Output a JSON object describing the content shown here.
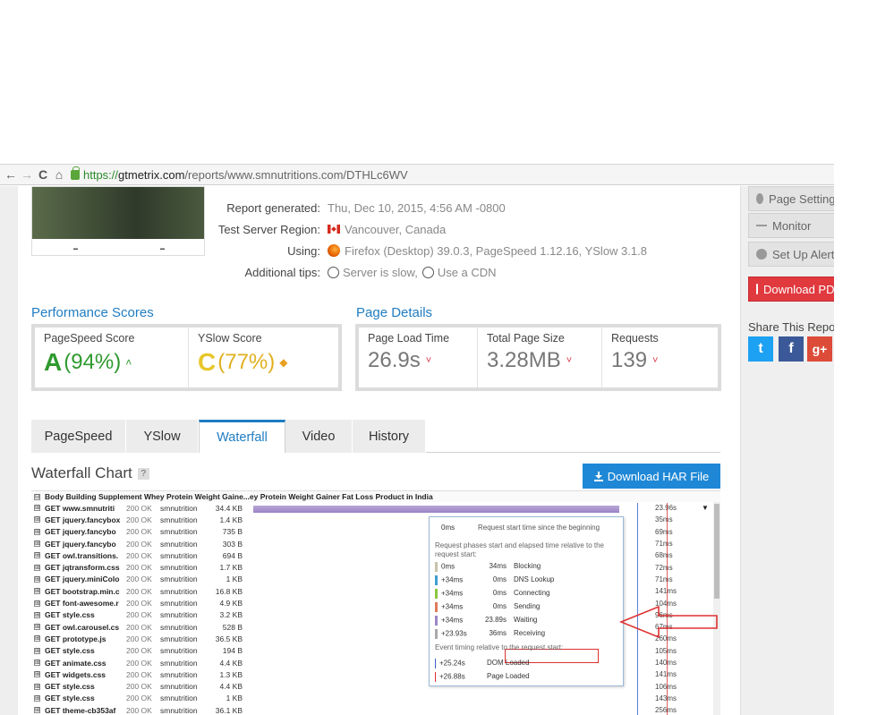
{
  "browser": {
    "back_icon": "←",
    "forward_icon": "→",
    "reload_icon": "C",
    "home_icon": "⌂",
    "url_https": "https://",
    "url_host": "gtmetrix.com",
    "url_path": "/reports/www.smnutritions.com/DTHLc6WV"
  },
  "report": {
    "rows": [
      {
        "label": "Report generated:",
        "value": "Thu, Dec 10, 2015, 4:56 AM -0800"
      },
      {
        "label": "Test Server Region:",
        "value": "Vancouver, Canada"
      },
      {
        "label": "Using:",
        "value": "Firefox (Desktop) 39.0.3, PageSpeed 1.12.16, YSlow 3.1.8"
      },
      {
        "label": "Additional tips:",
        "value": "Server is slow,",
        "value2": "Use a CDN"
      }
    ]
  },
  "performance": {
    "title": "Performance Scores",
    "pagespeed": {
      "label": "PageSpeed Score",
      "grade": "A",
      "pct": "(94%)",
      "trend": "˄"
    },
    "yslow": {
      "label": "YSlow Score",
      "grade": "C",
      "pct": "(77%)",
      "trend": "◆"
    }
  },
  "details": {
    "title": "Page Details",
    "items": [
      {
        "label": "Page Load Time",
        "value": "26.9s"
      },
      {
        "label": "Total Page Size",
        "value": "3.28MB"
      },
      {
        "label": "Requests",
        "value": "139"
      }
    ],
    "down": "˅"
  },
  "tabs": [
    "PageSpeed",
    "YSlow",
    "Waterfall",
    "Video",
    "History"
  ],
  "waterfall": {
    "title": "Waterfall Chart",
    "help": "?",
    "download_label": "Download HAR File",
    "page_title": "Body Building Supplement Whey Protein Weight Gaine...ey Protein Weight Gainer Fat Loss Product in India",
    "plus": "⊞",
    "minus": "⊟",
    "first_time": "23.96s",
    "rows": [
      {
        "name": "GET www.smnutriti",
        "status": "200 OK",
        "domain": "smnutrition",
        "size": "34.4 KB",
        "time": "23.96s"
      },
      {
        "name": "GET jquery.fancybox",
        "status": "200 OK",
        "domain": "smnutrition",
        "size": "1.4 KB",
        "time": "35ms"
      },
      {
        "name": "GET jquery.fancybo",
        "status": "200 OK",
        "domain": "smnutrition",
        "size": "735 B",
        "time": "69ms"
      },
      {
        "name": "GET jquery.fancybo",
        "status": "200 OK",
        "domain": "smnutrition",
        "size": "303 B",
        "time": "71ms"
      },
      {
        "name": "GET owl.transitions.",
        "status": "200 OK",
        "domain": "smnutrition",
        "size": "694 B",
        "time": "68ms"
      },
      {
        "name": "GET jqtransform.css",
        "status": "200 OK",
        "domain": "smnutrition",
        "size": "1.7 KB",
        "time": "72ms"
      },
      {
        "name": "GET jquery.miniColo",
        "status": "200 OK",
        "domain": "smnutrition",
        "size": "1 KB",
        "time": "71ms"
      },
      {
        "name": "GET bootstrap.min.c",
        "status": "200 OK",
        "domain": "smnutrition",
        "size": "16.8 KB",
        "time": "141ms"
      },
      {
        "name": "GET font-awesome.r",
        "status": "200 OK",
        "domain": "smnutrition",
        "size": "4.9 KB",
        "time": "104ms"
      },
      {
        "name": "GET style.css",
        "status": "200 OK",
        "domain": "smnutrition",
        "size": "3.2 KB",
        "time": "96ms"
      },
      {
        "name": "GET owl.carousel.cs",
        "status": "200 OK",
        "domain": "smnutrition",
        "size": "528 B",
        "time": "67ms"
      },
      {
        "name": "GET prototype.js",
        "status": "200 OK",
        "domain": "smnutrition",
        "size": "36.5 KB",
        "time": "260ms"
      },
      {
        "name": "GET style.css",
        "status": "200 OK",
        "domain": "smnutrition",
        "size": "194 B",
        "time": "105ms"
      },
      {
        "name": "GET animate.css",
        "status": "200 OK",
        "domain": "smnutrition",
        "size": "4.4 KB",
        "time": "140ms"
      },
      {
        "name": "GET widgets.css",
        "status": "200 OK",
        "domain": "smnutrition",
        "size": "1.3 KB",
        "time": "141ms"
      },
      {
        "name": "GET style.css",
        "status": "200 OK",
        "domain": "smnutrition",
        "size": "4.4 KB",
        "time": "106ms"
      },
      {
        "name": "GET style.css",
        "status": "200 OK",
        "domain": "smnutrition",
        "size": "1 KB",
        "time": "143ms"
      },
      {
        "name": "GET theme-cb353af",
        "status": "200 OK",
        "domain": "smnutrition",
        "size": "36.1 KB",
        "time": "256ms"
      }
    ]
  },
  "tooltip": {
    "start_time": "0ms",
    "start_text": "Request start time since the beginning",
    "phases_text": "Request phases start and elapsed time relative to the request start:",
    "phases": [
      {
        "start": "0ms",
        "elapsed": "34ms",
        "name": "Blocking",
        "color": "#c8c2a8"
      },
      {
        "start": "+34ms",
        "elapsed": "0ms",
        "name": "DNS Lookup",
        "color": "#3f9fcf"
      },
      {
        "start": "+34ms",
        "elapsed": "0ms",
        "name": "Connecting",
        "color": "#8cc63f"
      },
      {
        "start": "+34ms",
        "elapsed": "0ms",
        "name": "Sending",
        "color": "#e07b5a"
      },
      {
        "start": "+34ms",
        "elapsed": "23.89s",
        "name": "Waiting",
        "color": "#9b87c7"
      },
      {
        "start": "+23.93s",
        "elapsed": "36ms",
        "name": "Receiving",
        "color": "#aaaaaa"
      }
    ],
    "events_text": "Event timing relative to the request start:",
    "events": [
      {
        "time": "+25.24s",
        "name": "DOM Loaded",
        "color": "#3a5fc7"
      },
      {
        "time": "+26.88s",
        "name": "Page Loaded",
        "color": "#e03030"
      }
    ]
  },
  "sidebar": {
    "buttons": [
      "Page Settings",
      "Monitor",
      "Set Up Alerts"
    ],
    "download": "Download PDF",
    "share": "Share This Report",
    "social": [
      "t",
      "f",
      "g+"
    ]
  }
}
